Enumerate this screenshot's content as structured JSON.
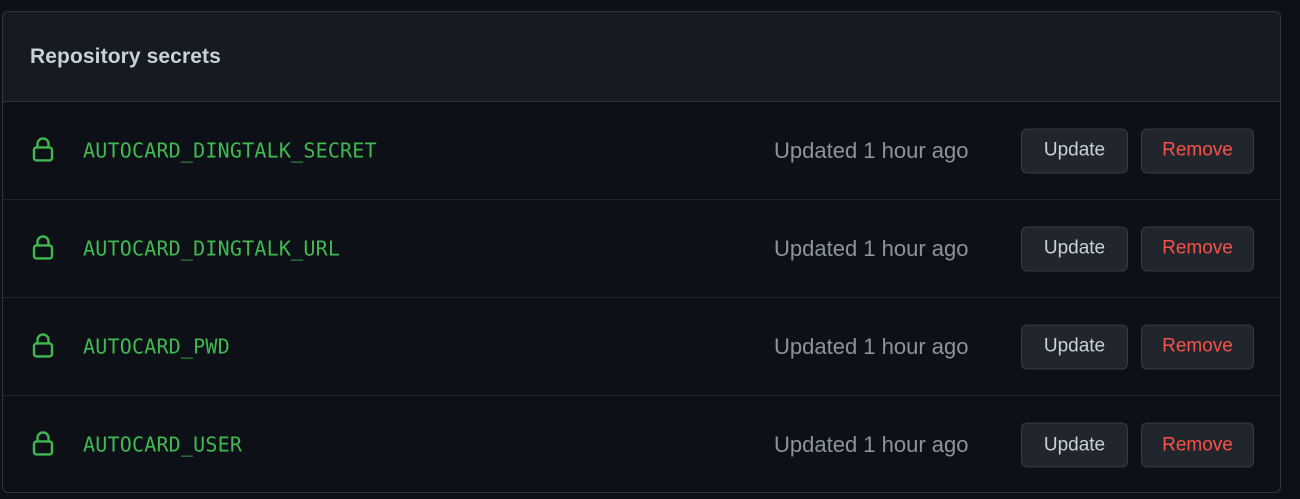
{
  "panel": {
    "title": "Repository secrets"
  },
  "secrets": [
    {
      "name": "AUTOCARD_DINGTALK_SECRET",
      "updated": "Updated 1 hour ago",
      "update_label": "Update",
      "remove_label": "Remove",
      "icon": "lock-icon"
    },
    {
      "name": "AUTOCARD_DINGTALK_URL",
      "updated": "Updated 1 hour ago",
      "update_label": "Update",
      "remove_label": "Remove",
      "icon": "lock-icon"
    },
    {
      "name": "AUTOCARD_PWD",
      "updated": "Updated 1 hour ago",
      "update_label": "Update",
      "remove_label": "Remove",
      "icon": "lock-icon"
    },
    {
      "name": "AUTOCARD_USER",
      "updated": "Updated 1 hour ago",
      "update_label": "Update",
      "remove_label": "Remove",
      "icon": "lock-icon"
    }
  ],
  "colors": {
    "background": "#0d1117",
    "header_background": "#161b22",
    "secret_name": "#3fb950",
    "muted_text": "#8b949e",
    "danger": "#f85149",
    "button_background": "#21262d",
    "border": "#30363d"
  }
}
